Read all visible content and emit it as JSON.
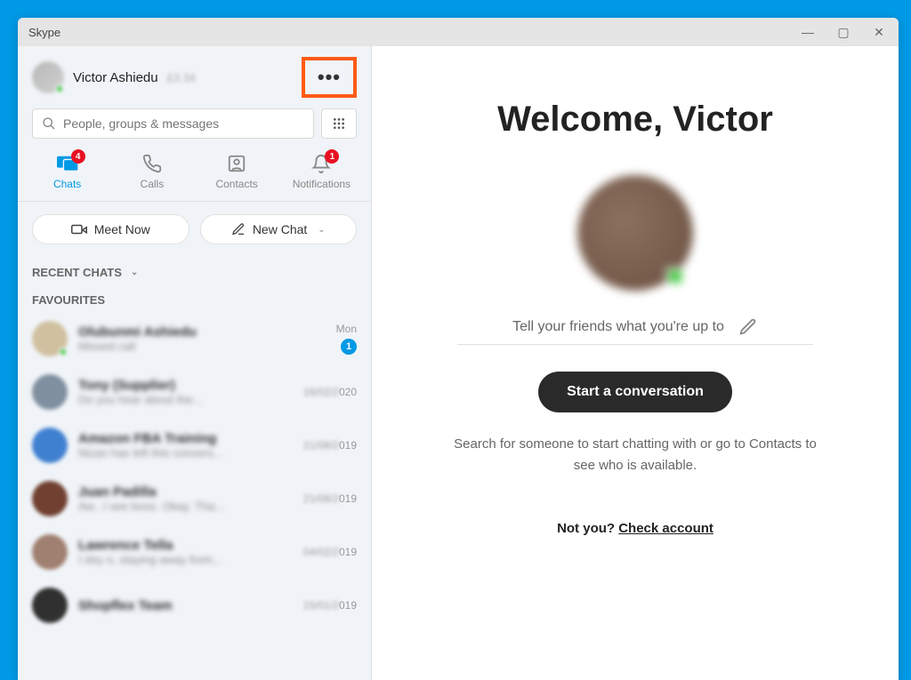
{
  "window": {
    "title": "Skype"
  },
  "profile": {
    "name": "Victor Ashiedu",
    "status_blur": "£3.34"
  },
  "search": {
    "placeholder": "People, groups & messages"
  },
  "tabs": {
    "chats": {
      "label": "Chats",
      "badge": "4"
    },
    "calls": {
      "label": "Calls"
    },
    "contacts": {
      "label": "Contacts"
    },
    "notifications": {
      "label": "Notifications",
      "badge": "1"
    }
  },
  "actions": {
    "meet_now": "Meet Now",
    "new_chat": "New Chat"
  },
  "sections": {
    "recent": "RECENT CHATS",
    "favourites": "FAVOURITES"
  },
  "chats": [
    {
      "name_blur": "Olubunmi Ashiedu",
      "preview_blur": "Missed call",
      "time_clear": "Mon",
      "time_blur": "",
      "badge": "1",
      "presence": true,
      "color": "#d0c0a0"
    },
    {
      "name_blur": "Tony (Supplier)",
      "preview_blur": "Do you hear about the...",
      "time_clear": "020",
      "time_blur": "16/02/2",
      "badge": "",
      "presence": false,
      "color": "#8090a0"
    },
    {
      "name_blur": "Amazon FBA Training",
      "preview_blur": "Nizan has left this convers...",
      "time_clear": "019",
      "time_blur": "21/08/2",
      "badge": "",
      "presence": false,
      "color": "#4080d0"
    },
    {
      "name_blur": "Juan Padilla",
      "preview_blur": "Aw.. I see boss. Okay. Tha...",
      "time_clear": "019",
      "time_blur": "21/08/2",
      "badge": "",
      "presence": false,
      "color": "#704030"
    },
    {
      "name_blur": "Lawrence Tella",
      "preview_blur": "I dey o, staying away from...",
      "time_clear": "019",
      "time_blur": "04/02/2",
      "badge": "",
      "presence": false,
      "color": "#a08070"
    },
    {
      "name_blur": "Shopflex Team",
      "preview_blur": "",
      "time_clear": "019",
      "time_blur": "15/01/2",
      "badge": "",
      "presence": false,
      "color": "#303030"
    }
  ],
  "main": {
    "welcome": "Welcome, Victor",
    "mood_placeholder": "Tell your friends what you're up to",
    "start_button": "Start a conversation",
    "hint": "Search for someone to start chatting with or go to Contacts to see who is available.",
    "notyou_prefix": "Not you? ",
    "notyou_link": "Check account"
  }
}
